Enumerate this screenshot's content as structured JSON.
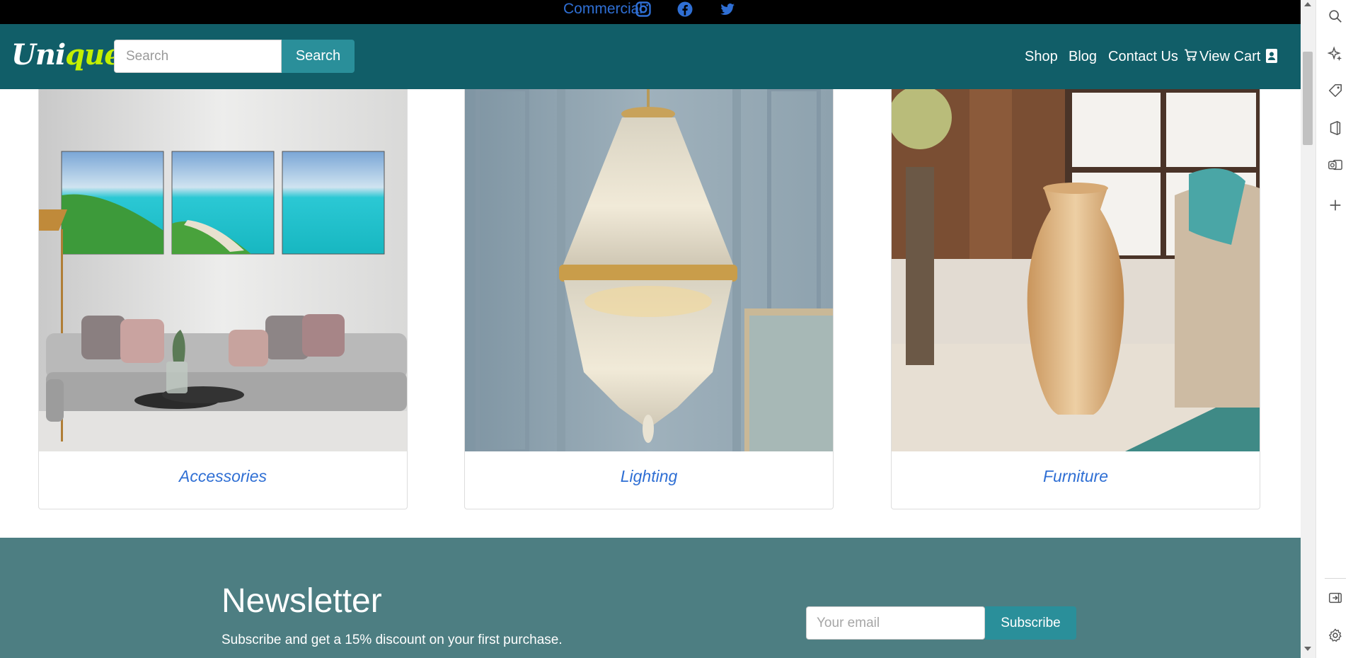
{
  "topbar": {
    "commercial_label": "Commercial",
    "social": [
      "instagram-icon",
      "facebook-icon",
      "twitter-icon"
    ]
  },
  "header": {
    "logo_main": "Uni",
    "logo_accent": "que",
    "logo_dot": ".",
    "search_placeholder": "Search",
    "search_button": "Search",
    "nav": {
      "shop": "Shop",
      "blog": "Blog",
      "contact": "Contact Us",
      "cart": "View Cart"
    }
  },
  "categories": [
    {
      "title": "Accessories",
      "image": "living-room-wall-art-image"
    },
    {
      "title": "Lighting",
      "image": "crystal-chandelier-image"
    },
    {
      "title": "Furniture",
      "image": "ceramic-vase-image"
    }
  ],
  "newsletter": {
    "title": "Newsletter",
    "text": "Subscribe and get a 15% discount on your first purchase.",
    "email_placeholder": "Your email",
    "button": "Subscribe"
  },
  "colors": {
    "header_bg": "#115e68",
    "accent_button": "#2a8f9a",
    "logo_accent": "#c4f000",
    "link": "#2f6fd4",
    "newsletter_bg": "#4d7e82"
  }
}
